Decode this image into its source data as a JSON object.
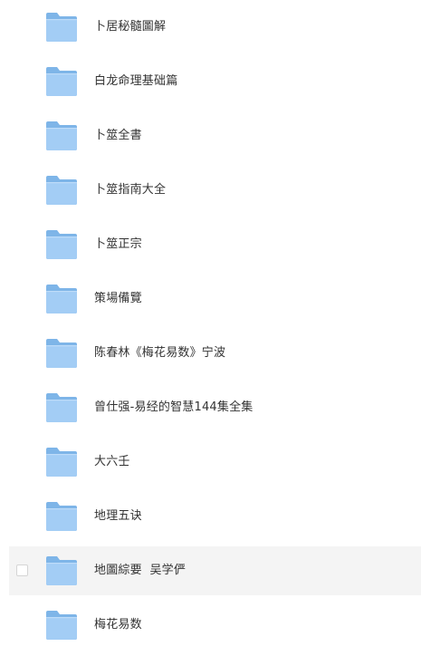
{
  "files": [
    {
      "name": "卜居秘髓圖解",
      "icon": "folder-icon"
    },
    {
      "name": "白龙命理基础篇",
      "icon": "folder-icon"
    },
    {
      "name": "卜筮全書",
      "icon": "folder-icon"
    },
    {
      "name": "卜筮指南大全",
      "icon": "folder-icon"
    },
    {
      "name": "卜筮正宗",
      "icon": "folder-icon"
    },
    {
      "name": "策場備覽",
      "icon": "folder-icon"
    },
    {
      "name": "陈春林《梅花易数》宁波",
      "icon": "folder-icon"
    },
    {
      "name": "曾仕强-易经的智慧144集全集",
      "icon": "folder-icon"
    },
    {
      "name": "大六壬",
      "icon": "folder-icon"
    },
    {
      "name": "地理五诀",
      "icon": "folder-icon"
    },
    {
      "name": "地圖綜要  吴学俨",
      "icon": "folder-icon",
      "hovered": true
    },
    {
      "name": "梅花易数",
      "icon": "folder-icon"
    }
  ],
  "colors": {
    "folder_back": "#7eb5e8",
    "folder_front": "#a3cdf5",
    "hover_bg": "#f4f4f4",
    "text": "#333333"
  }
}
